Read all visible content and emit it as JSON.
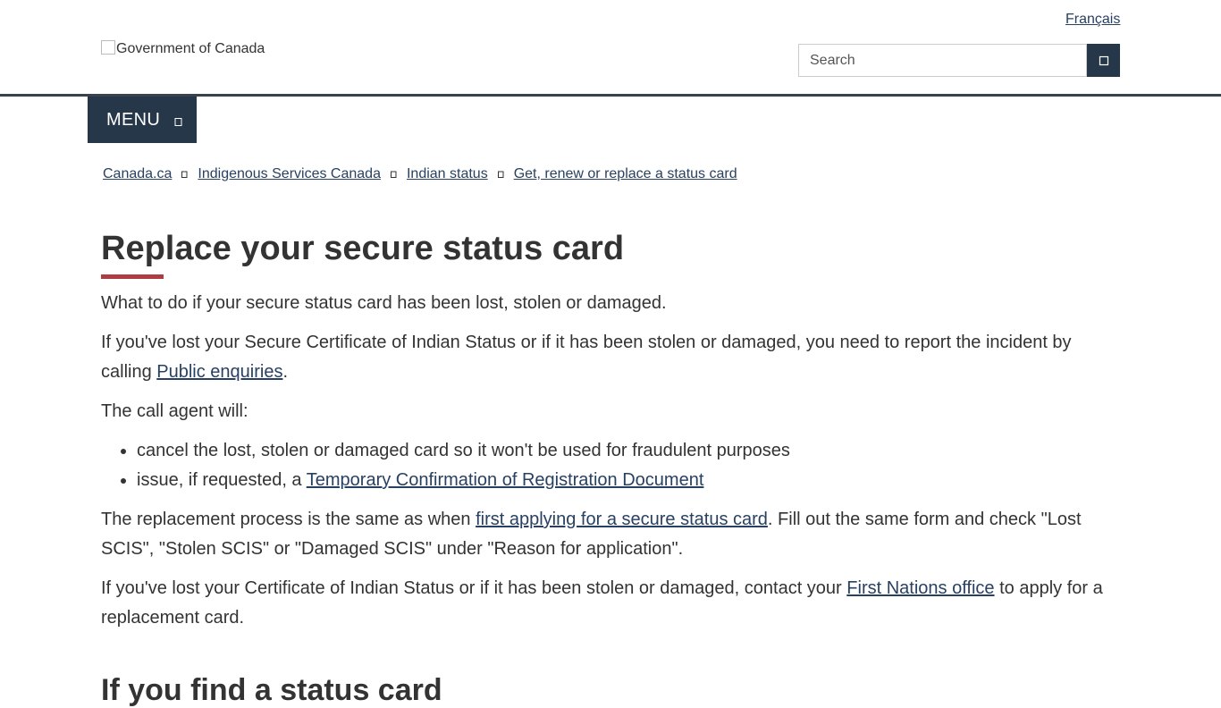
{
  "header": {
    "language_link": "Français",
    "logo_alt": "Government of Canada",
    "search_placeholder": "Search"
  },
  "menu": {
    "label": "MENU"
  },
  "breadcrumb": [
    "Canada.ca",
    "Indigenous Services Canada",
    "Indian status",
    "Get, renew or replace a status card"
  ],
  "content": {
    "title": "Replace your secure status card",
    "intro": "What to do if your secure status card has been lost, stolen or damaged.",
    "p1_text": "If you've lost your Secure Certificate of Indian Status or if it has been stolen or damaged, you need to report the incident by calling ",
    "p1_link": "Public enquiries",
    "p1_end": ".",
    "p2": "The call agent will:",
    "bullet1": "cancel the lost, stolen or damaged card so it won't be used for fraudulent purposes",
    "bullet2_text": "issue, if requested, a ",
    "bullet2_link": "Temporary Confirmation of Registration Document",
    "p3_text": "The replacement process is the same as when ",
    "p3_link": "first applying for a secure status card",
    "p3_end": ". Fill out the same form and check \"Lost SCIS\", \"Stolen SCIS\" or \"Damaged SCIS\" under \"Reason for application\".",
    "p4_text": "If you've lost your Certificate of Indian Status or if it has been stolen or damaged, contact your ",
    "p4_link": "First Nations office",
    "p4_end": " to apply for a replacement card.",
    "h2": "If you find a status card"
  },
  "colors": {
    "brand_dark": "#26374a",
    "link": "#284162",
    "title_accent": "#af3c43",
    "header_rule": "#38414d"
  },
  "icons": {
    "search_button": "search-icon",
    "menu": "chevron-down-icon",
    "breadcrumb_separator": "chevron-right-icon",
    "logo": "broken-image-icon"
  }
}
